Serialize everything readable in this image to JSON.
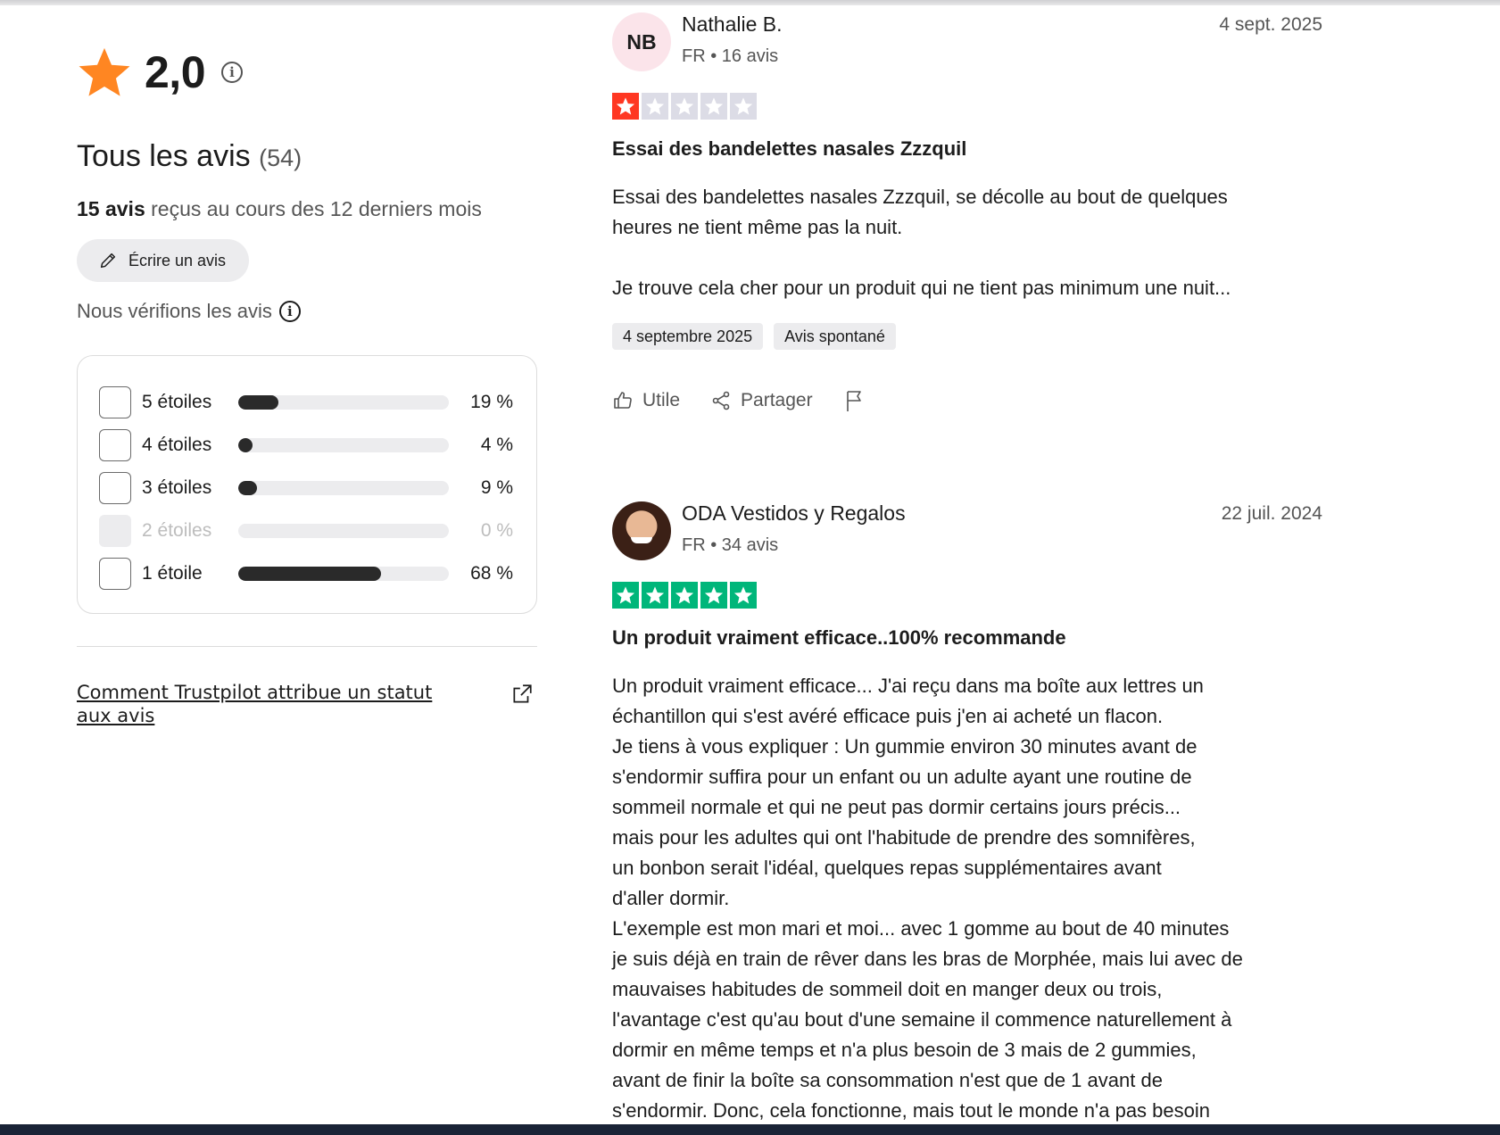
{
  "summary": {
    "rating": "2,0",
    "all_reviews_label": "Tous les avis",
    "all_reviews_count": "(54)",
    "recent_count": "15 avis",
    "recent_suffix": "reçus au cours des 12 derniers mois",
    "write_review_label": "Écrire un avis",
    "verify_label": "Nous vérifions les avis",
    "status_link_label": "Comment Trustpilot attribue un statut aux avis"
  },
  "distribution": [
    {
      "label": "5 étoiles",
      "percent_label": "19 %",
      "fraction": 0.19,
      "disabled": false
    },
    {
      "label": "4 étoiles",
      "percent_label": "4 %",
      "fraction": 0.04,
      "disabled": false
    },
    {
      "label": "3 étoiles",
      "percent_label": "9 %",
      "fraction": 0.09,
      "disabled": false
    },
    {
      "label": "2 étoiles",
      "percent_label": "0 %",
      "fraction": 0.0,
      "disabled": true
    },
    {
      "label": "1 étoile",
      "percent_label": "68 %",
      "fraction": 0.68,
      "disabled": false
    }
  ],
  "reviews": [
    {
      "initials": "NB",
      "name": "Nathalie B.",
      "meta": "FR • 16 avis",
      "date": "4 sept. 2025",
      "rating": 1,
      "title": "Essai des bandelettes nasales Zzzquil",
      "body": "Essai des bandelettes nasales Zzzquil, se décolle au bout de quelques\nheures ne tient même pas la nuit.\n\nJe trouve cela cher pour un produit qui ne tient pas minimum une nuit...",
      "tags": [
        "4 septembre 2025",
        "Avis spontané"
      ]
    },
    {
      "initials": "",
      "name": "ODA Vestidos y Regalos",
      "meta": "FR • 34 avis",
      "date": "22 juil. 2024",
      "rating": 5,
      "title": "Un produit vraiment efficace..100% recommande",
      "body": "Un produit vraiment efficace... J'ai reçu dans ma boîte aux lettres un\néchantillon qui s'est avéré efficace puis j'en ai acheté un flacon.\nJe tiens à vous expliquer : Un gummie environ 30 minutes avant de\ns'endormir suffira pour un enfant ou un adulte ayant une routine de\nsommeil normale et qui ne peut pas dormir certains jours précis...\nmais pour les adultes qui ont l'habitude de prendre des somnifères,\nun bonbon serait l'idéal, quelques repas supplémentaires avant\nd'aller dormir.\nL'exemple est mon mari et moi... avec 1 gomme au bout de 40 minutes\nje suis déjà en train de rêver dans les bras de Morphée, mais lui avec de\nmauvaises habitudes de sommeil doit en manger deux ou trois,\nl'avantage c'est qu'au bout d'une semaine il commence naturellement à\ndormir en même temps et n'a plus besoin de 3 mais de 2 gummies,\navant de finir la boîte sa consommation n'est que de 1 avant de\ns'endormir. Donc, cela fonctionne, mais tout le monde n'a pas besoin"
    }
  ],
  "actions": {
    "useful_label": "Utile",
    "share_label": "Partager"
  },
  "colors": {
    "summary_star": "#ff8622",
    "one_star": "#ff3722",
    "five_star": "#00b67a",
    "empty_star": "#dcdce6",
    "bar_fill": "#2a2a2a"
  },
  "icons": [
    "star-icon",
    "info-icon",
    "pencil-icon",
    "thumbs-up-icon",
    "share-icon",
    "flag-icon",
    "external-link-icon"
  ]
}
